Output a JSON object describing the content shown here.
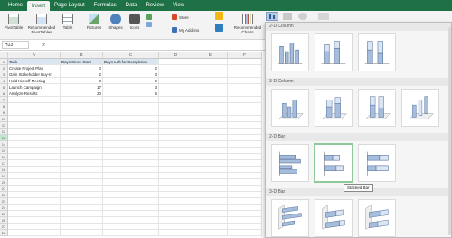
{
  "tabs": [
    "Home",
    "Insert",
    "Page Layout",
    "Formulas",
    "Data",
    "Review",
    "View"
  ],
  "active_tab": "Insert",
  "ribbon": {
    "pivottable": "PivotTable",
    "recommended_pivot": "Recommended PivotTables",
    "table": "Table",
    "pictures": "Pictures",
    "shapes": "Shapes",
    "icons": "Icons",
    "store": "Store",
    "my_addins": "My Add-ins",
    "recommended_charts": "Recommended Charts"
  },
  "name_box": "H13",
  "fx_label": "fx",
  "columns": [
    "A",
    "B",
    "C",
    "D",
    "E",
    "F"
  ],
  "rows": [
    "1",
    "2",
    "3",
    "4",
    "5",
    "6",
    "7",
    "8",
    "9",
    "10",
    "11",
    "12",
    "13",
    "14",
    "15",
    "16",
    "17",
    "18",
    "19",
    "20",
    "21",
    "22",
    "23",
    "24",
    "25",
    "26",
    "27",
    "28"
  ],
  "table": {
    "headers": [
      "Task",
      "Days Since Start",
      "Days Left for Completion"
    ],
    "rows": [
      [
        "Create Project Plan",
        "0",
        "2"
      ],
      [
        "Gain Stakeholder Buy-In",
        "2",
        "3"
      ],
      [
        "Hold Kickoff Meeting",
        "8",
        "9"
      ],
      [
        "Launch Campaign",
        "17",
        "3"
      ],
      [
        "Analyze Results",
        "20",
        "5"
      ]
    ]
  },
  "chart_menu": {
    "sections": [
      "2-D Column",
      "3-D Column",
      "2-D Bar",
      "3-D Bar"
    ],
    "tooltip": "Stacked Bar"
  },
  "colors": {
    "excel_green": "#1e7145",
    "header_fill": "#dbe5f1",
    "selection": "#8fc89b"
  }
}
